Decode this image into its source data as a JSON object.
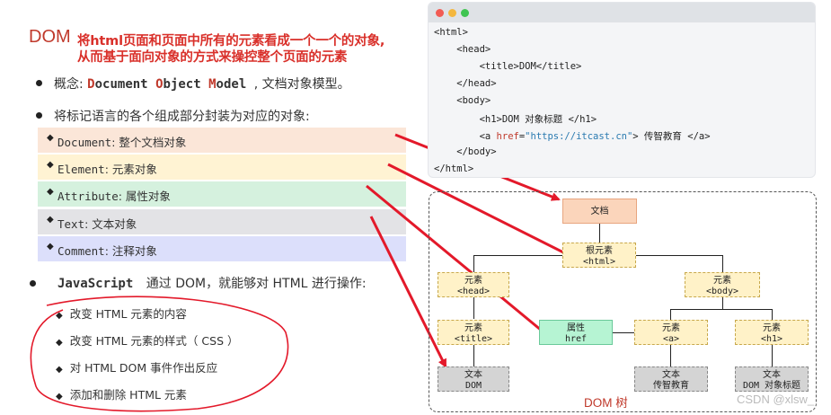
{
  "heading": {
    "dom": "DOM",
    "line1": "将html页面和页面中所有的元素看成一个一个的对象,",
    "line2": "从而基于面向对象的方式来操控整个页面的元素"
  },
  "concept": {
    "prefix": "概念:",
    "w1_first": "D",
    "w1_rest": "ocument",
    "w2_first": "O",
    "w2_rest": "bject",
    "w3_first": "M",
    "w3_rest": "odel",
    "suffix": ", 文档对象模型。"
  },
  "encapsulate": "将标记语言的各个组成部分封装为对应的对象:",
  "objects": [
    {
      "kw": "Document",
      "desc": ": 整个文档对象",
      "color": "#fbe6d8"
    },
    {
      "kw": "Element",
      "desc": ": 元素对象",
      "color": "#fff3d3"
    },
    {
      "kw": "Attribute",
      "desc": ": 属性对象",
      "color": "#d5f1de"
    },
    {
      "kw": "Text",
      "desc": ": 文本对象",
      "color": "#e3e3e6"
    },
    {
      "kw": "Comment",
      "desc": ": 注释对象",
      "color": "#dcdffb"
    }
  ],
  "js_line": {
    "kw": "JavaScript",
    "text": "通过 DOM，就能够对 HTML 进行操作:"
  },
  "operations": [
    "改变  HTML  元素的内容",
    "改变  HTML  元素的样式（ CSS ）",
    "对  HTML DOM  事件作出反应",
    "添加和删除  HTML  元素"
  ],
  "code": [
    "<html>",
    "    <head>",
    "        <title>DOM</title>",
    "    </head>",
    "    <body>",
    "        <h1>DOM 对象标题 </h1>",
    "        <a href=\"https://itcast.cn\"> 传智教育 </a>",
    "    </body>",
    "</html>"
  ],
  "window_dots": [
    "#f25c54",
    "#f4b73e",
    "#3fc451"
  ],
  "tree": {
    "doc": "文档",
    "root_l1": "根元素",
    "root_l2": "<html>",
    "head_l1": "元素",
    "head_l2": "<head>",
    "body_l1": "元素",
    "body_l2": "<body>",
    "title_l1": "元素",
    "title_l2": "<title>",
    "attr_l1": "属性",
    "attr_l2": "href",
    "a_l1": "元素",
    "a_l2": "<a>",
    "h1_l1": "元素",
    "h1_l2": "<h1>",
    "t1_l1": "文本",
    "t1_l2": "DOM",
    "t2_l1": "文本",
    "t2_l2": "传智教育",
    "t3_l1": "文本",
    "t3_l2": "DOM 对象标题",
    "caption": "DOM 树"
  },
  "watermark": "CSDN @xlsw_",
  "colors": {
    "accent_red": "#d9302a",
    "arrow_red": "#e3192a"
  }
}
